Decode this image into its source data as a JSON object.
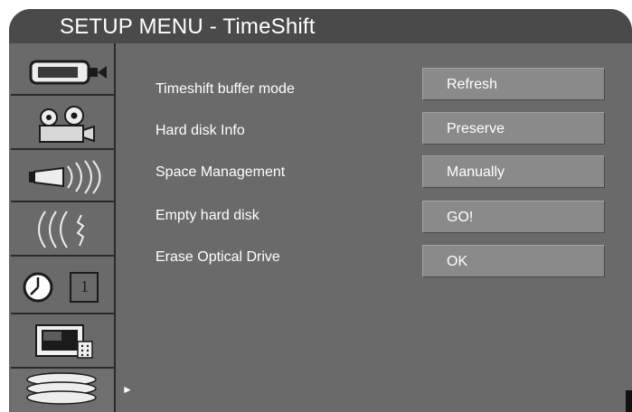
{
  "header": {
    "title": "SETUP MENU - TimeShift"
  },
  "sidebar": {
    "items": [
      {
        "name": "video-camera-icon"
      },
      {
        "name": "film-projector-icon"
      },
      {
        "name": "speaker-sound-icon"
      },
      {
        "name": "signal-waves-icon"
      },
      {
        "name": "clock-timer-icon",
        "label": "1"
      },
      {
        "name": "tv-screen-icon"
      },
      {
        "name": "disc-stack-icon",
        "active": true
      }
    ]
  },
  "menu": {
    "rows": [
      {
        "label": "Timeshift buffer mode",
        "value": "Refresh"
      },
      {
        "label": "Hard disk Info",
        "value": "Preserve"
      },
      {
        "label": "Space Management",
        "value": "Manually"
      },
      {
        "label": "Empty hard disk",
        "value": "GO!"
      },
      {
        "label": "Erase Optical Drive",
        "value": "OK"
      }
    ]
  },
  "pointer": {
    "glyph": "►"
  },
  "colors": {
    "panel": "#6a6a6a",
    "title_bar": "#4a4a4a",
    "value_box": "#8a8a8a",
    "text": "#ffffff"
  }
}
